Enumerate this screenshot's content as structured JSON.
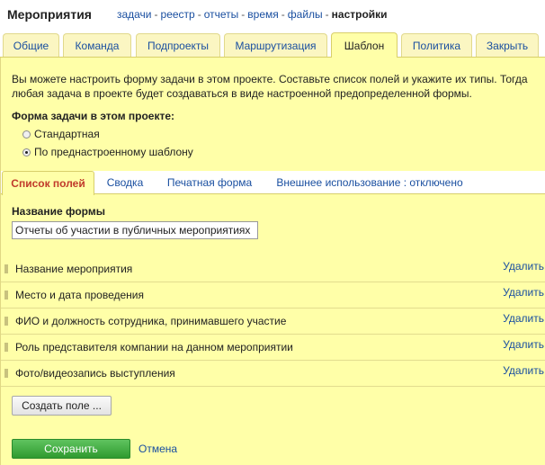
{
  "header": {
    "project_title": "Мероприятия",
    "nav": [
      {
        "label": "задачи"
      },
      {
        "label": "реестр"
      },
      {
        "label": "отчеты"
      },
      {
        "label": "время"
      },
      {
        "label": "файлы"
      }
    ],
    "separator": "-",
    "current": "настройки"
  },
  "tabs": [
    {
      "label": "Общие"
    },
    {
      "label": "Команда"
    },
    {
      "label": "Подпроекты"
    },
    {
      "label": "Маршрутизация"
    },
    {
      "label": "Шаблон"
    },
    {
      "label": "Политика"
    },
    {
      "label": "Закрыть"
    }
  ],
  "active_tab": "Шаблон",
  "template": {
    "description": "Вы можете настроить форму задачи в этом проекте. Составьте список полей и укажите их типы. Тогда любая задача в проекте будет создаваться в виде настроенной предопределенной формы.",
    "form_label": "Форма задачи в этом проекте:",
    "radio_standard": "Стандартная",
    "radio_template": "По преднастроенному шаблону",
    "selected_option": "По преднастроенному шаблону"
  },
  "subtabs": [
    {
      "label": "Список полей"
    },
    {
      "label": "Сводка"
    },
    {
      "label": "Печатная форма"
    },
    {
      "label": "Внешнее использование : отключено"
    }
  ],
  "active_subtab": "Список полей",
  "form_name": {
    "label": "Название формы",
    "value": "Отчеты об участии в публичных мероприятиях"
  },
  "fields": [
    {
      "name": "Название мероприятия",
      "delete": "Удалить"
    },
    {
      "name": "Место и дата проведения",
      "delete": "Удалить"
    },
    {
      "name": "ФИО и должность сотрудника, принимавшего участие",
      "delete": "Удалить"
    },
    {
      "name": "Роль представителя компании на данном мероприятии",
      "delete": "Удалить"
    },
    {
      "name": "Фото/видеозапись выступления",
      "delete": "Удалить"
    }
  ],
  "buttons": {
    "create_field": "Создать поле ...",
    "save": "Сохранить",
    "cancel": "Отмена"
  },
  "colors": {
    "panel_bg": "#ffffa8",
    "link": "#1a4fa0",
    "active_subtab_text": "#c0392b",
    "save_button": "#3fa83f"
  }
}
